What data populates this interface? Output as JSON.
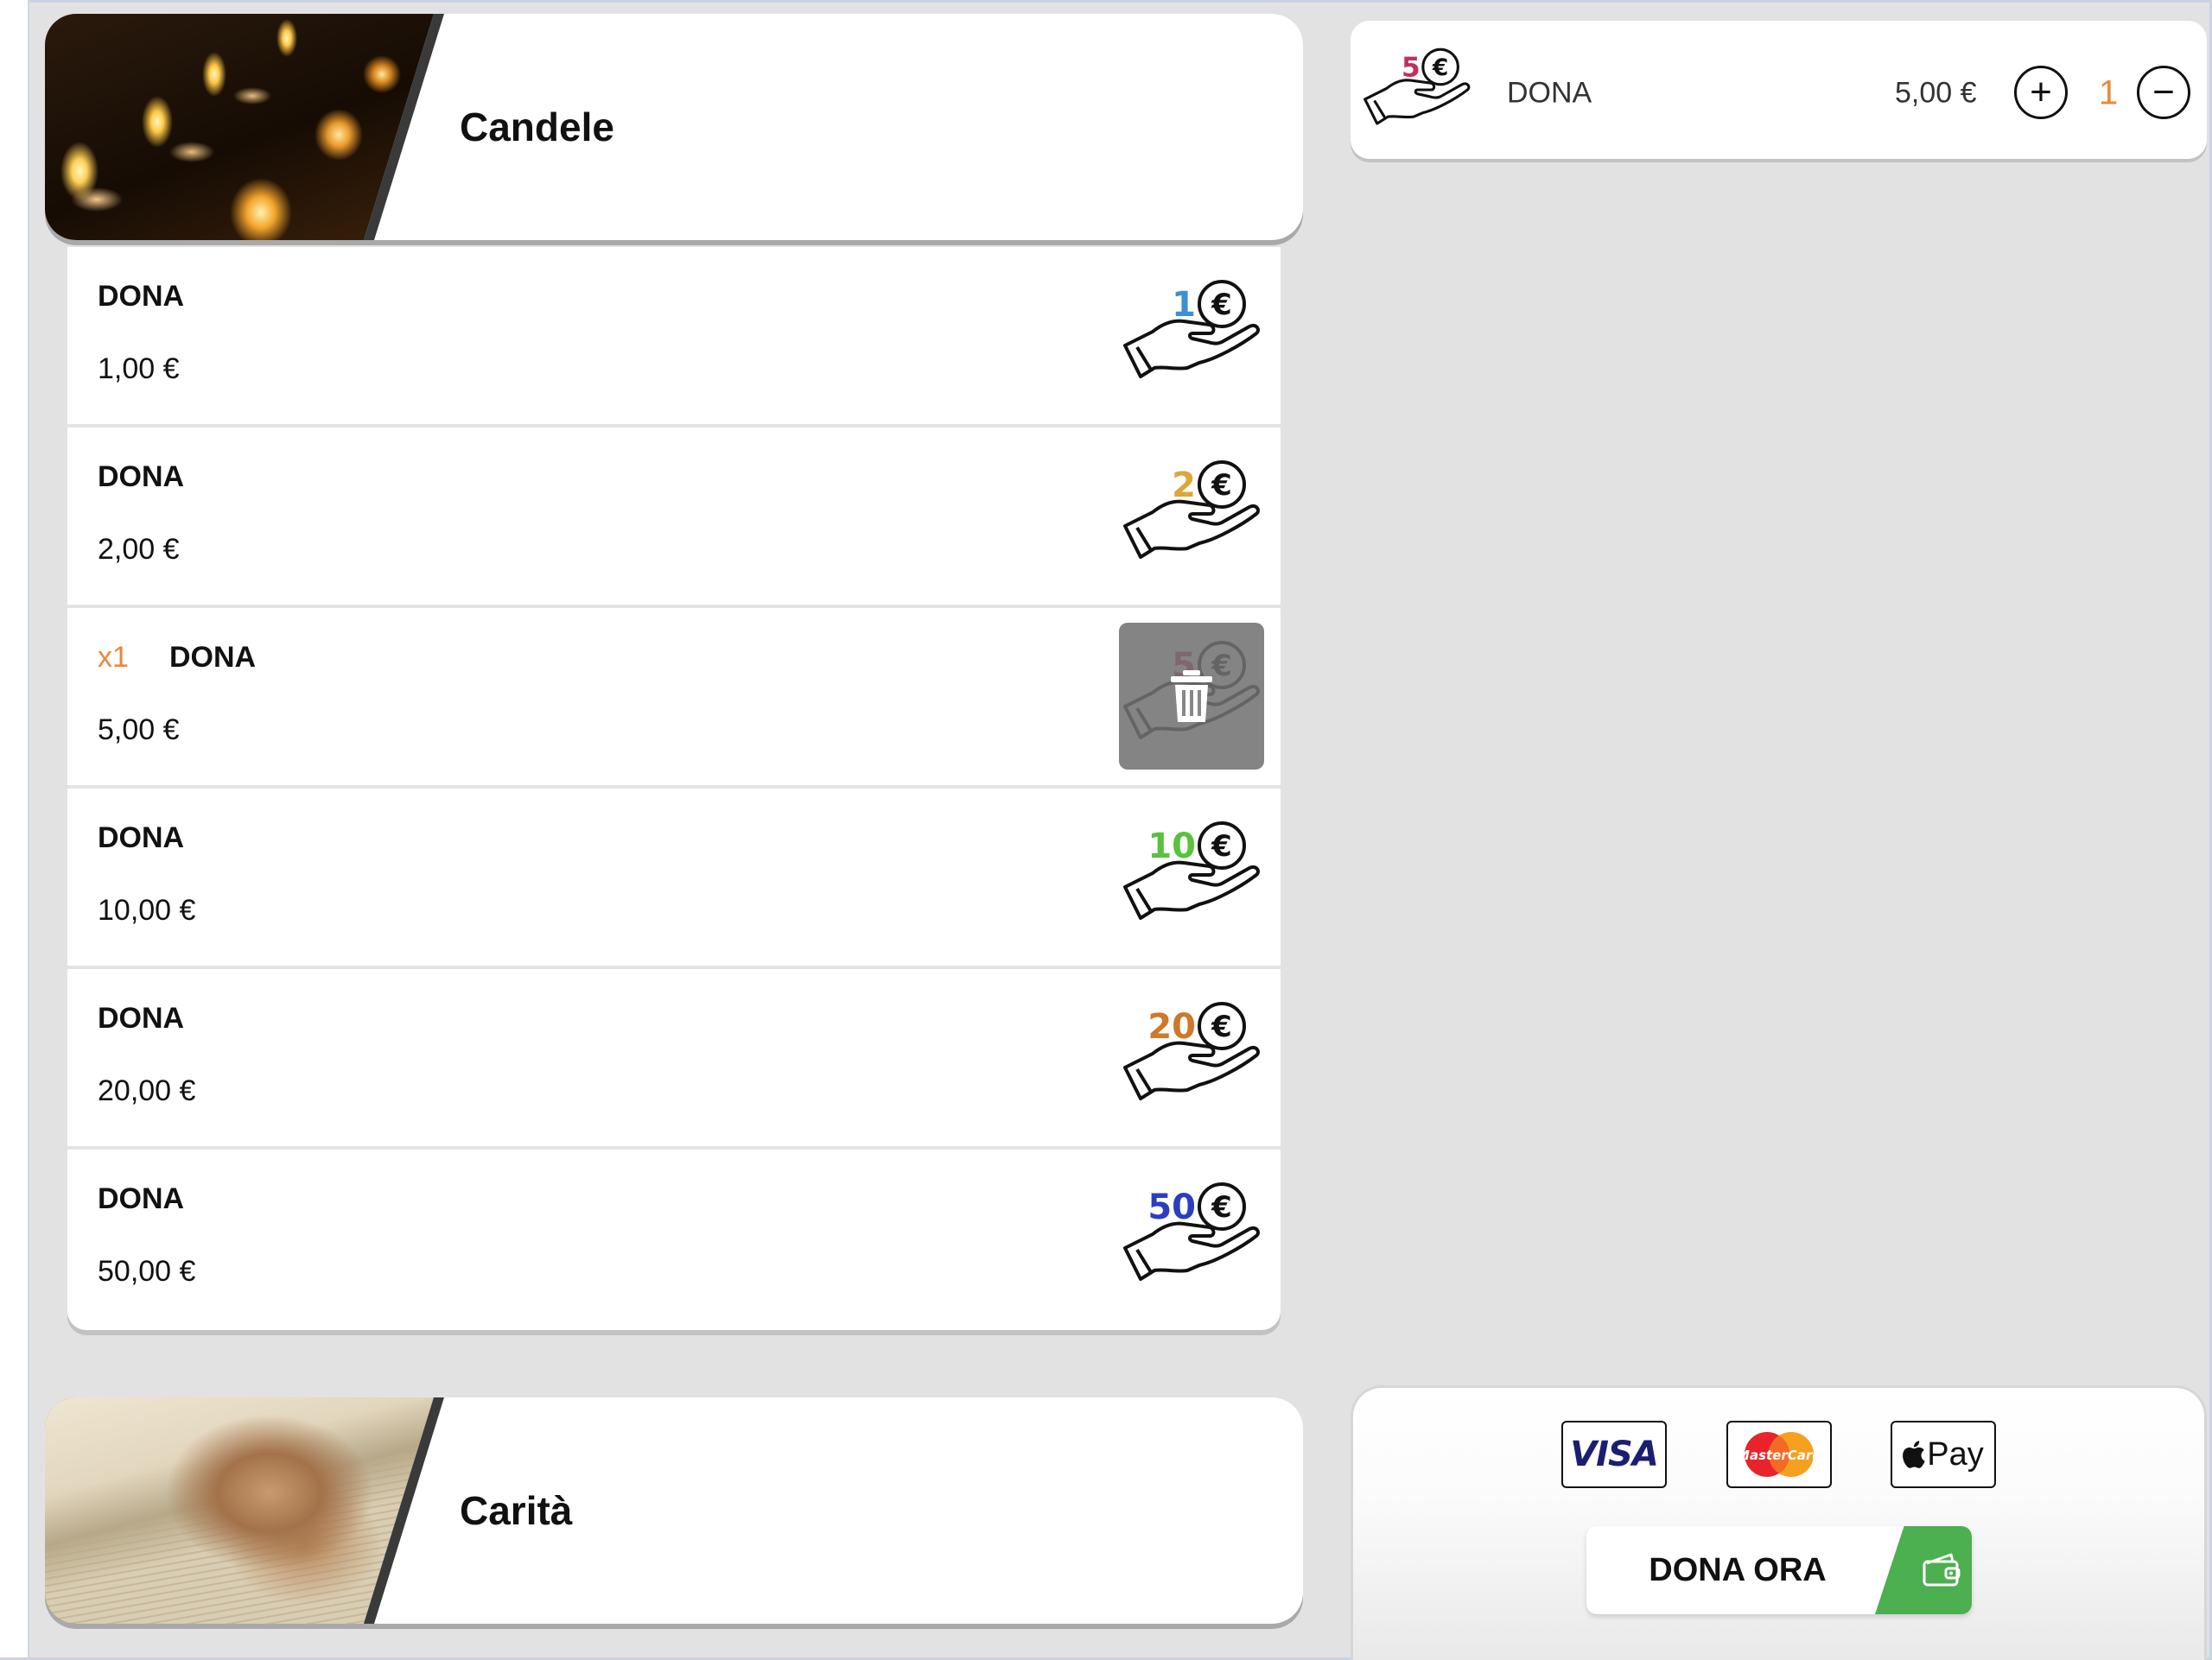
{
  "categories": [
    {
      "title": "Candele",
      "image": "candles-photo"
    },
    {
      "title": "Carità",
      "image": "praying-hands-photo"
    }
  ],
  "donations": [
    {
      "label": "DONA",
      "price": "1,00 €",
      "badge": "1",
      "badge_color": "#3d8fd6",
      "selected": false
    },
    {
      "label": "DONA",
      "price": "2,00 €",
      "badge": "2",
      "badge_color": "#d8a83a",
      "selected": false
    },
    {
      "label": "DONA",
      "price": "5,00 €",
      "badge": "5",
      "badge_color": "#c0305c",
      "selected": true,
      "qty": "x1"
    },
    {
      "label": "DONA",
      "price": "10,00 €",
      "badge": "10",
      "badge_color": "#58c23c",
      "selected": false
    },
    {
      "label": "DONA",
      "price": "20,00 €",
      "badge": "20",
      "badge_color": "#d0772a",
      "selected": false
    },
    {
      "label": "DONA",
      "price": "50,00 €",
      "badge": "50",
      "badge_color": "#2a3fc0",
      "selected": false
    }
  ],
  "cart": {
    "item_name": "DONA",
    "item_price": "5,00 €",
    "quantity": "1",
    "badge": "5",
    "badge_color": "#c0305c",
    "plus_symbol": "+",
    "minus_symbol": "−"
  },
  "payment": {
    "methods": [
      {
        "name": "VISA",
        "icon": "visa-logo"
      },
      {
        "name": "MasterCard",
        "icon": "mastercard-logo"
      },
      {
        "name": "Pay",
        "icon": "apple-pay-logo"
      }
    ],
    "cta_label": "DONA ORA",
    "cta_icon": "wallet-icon",
    "cta_color": "#4caf50"
  },
  "colors": {
    "accent_orange": "#e8893a",
    "background": "#e2e2e2"
  }
}
